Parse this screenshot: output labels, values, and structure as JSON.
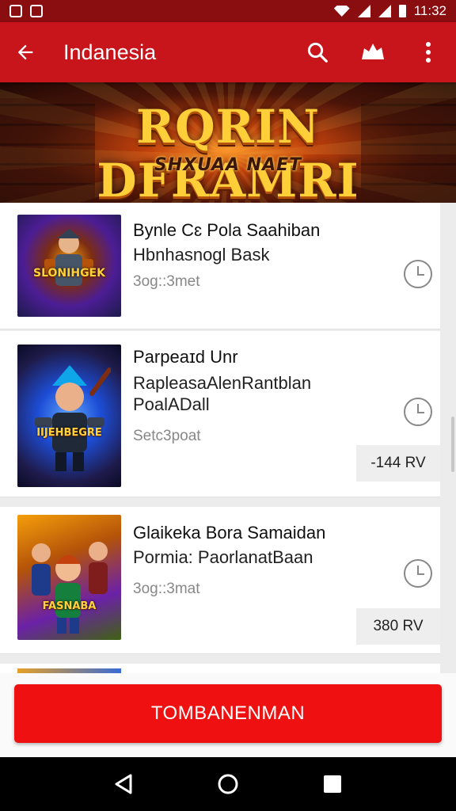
{
  "status_bar": {
    "time": "11:32"
  },
  "app_bar": {
    "title": "Indanesia"
  },
  "banner": {
    "title": "RQRIN DFRAMRI",
    "subtitle": "SHXUAA NAET"
  },
  "items": [
    {
      "name": "Bynle Cɛ Pola Saahiban",
      "desc": "Hbnhasnogl Bask",
      "time": "3og::3met",
      "thumb_caption": "SLONIHGEK",
      "price": ""
    },
    {
      "name": "Parpeaɪd Unr",
      "desc": "RapleasaAlenRantblan PoalADall",
      "time": "Setc3poat",
      "thumb_caption": "IIJEHBEGRE",
      "price": "-144 RV"
    },
    {
      "name": "Glaikeka Bora Samaidan",
      "desc": "Pormia: PaorlanatBaan",
      "time": "3og::3mat",
      "thumb_caption": "FASNABA",
      "price": "380 RV"
    }
  ],
  "cta": {
    "label": "TOMBANENMAN"
  },
  "colors": {
    "primary": "#c8141b",
    "status": "#8a0d10",
    "cta": "#ef1111"
  },
  "icons": {
    "back": "arrow-back-icon",
    "search": "search-icon",
    "badge": "badge-icon",
    "more": "more-vert-icon",
    "time": "clock-icon",
    "nav_back": "nav-back-icon",
    "nav_home": "nav-home-icon",
    "nav_recent": "nav-recent-icon"
  }
}
